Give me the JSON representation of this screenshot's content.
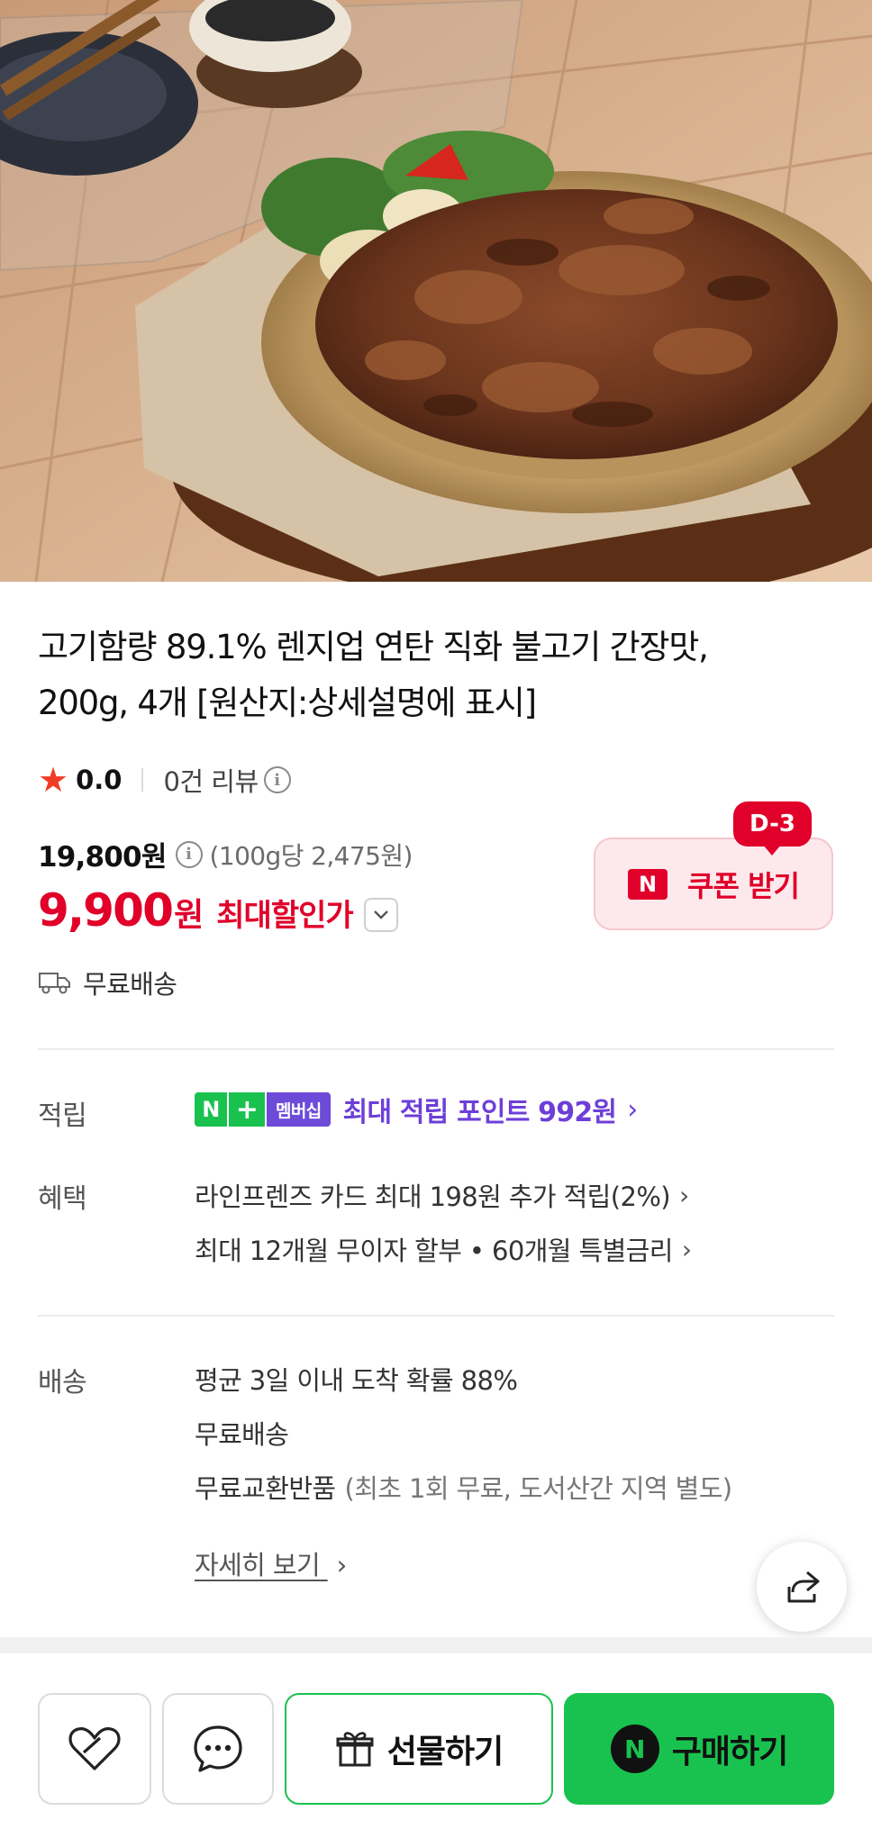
{
  "product": {
    "title_line1": "고기함량 89.1% 렌지업 연탄 직화 불고기 간장맛,",
    "title_line2": "200g, 4개 [원산지:상세설명에 표시]",
    "image_icon": "bulgogi-plate-photo"
  },
  "rating": {
    "star_icon": "star-icon",
    "value": "0.0",
    "review_count": "0건 리뷰"
  },
  "price": {
    "original": "19,800원",
    "unit_price": "(100g당 2,475원)",
    "sale_amount": "9,900",
    "sale_currency": "원",
    "sale_label": "최대할인가"
  },
  "coupon": {
    "badge": "D-3",
    "n_label": "N",
    "label": "쿠폰 받기"
  },
  "shipping_summary": "무료배송",
  "points": {
    "label": "적립",
    "badge_n": "N",
    "badge_plus": "+",
    "badge_membership": "멤버십",
    "text": "최대 적립 포인트 992원"
  },
  "benefits": {
    "label": "혜택",
    "items": [
      "라인프렌즈 카드 최대 198원 추가 적립(2%)",
      "최대 12개월 무이자 할부 • 60개월 특별금리"
    ]
  },
  "delivery": {
    "label": "배송",
    "line1": "평균 3일 이내 도착 확률 88%",
    "line2": "무료배송",
    "line3_main": "무료교환반품",
    "line3_note": "(최초 1회 무료, 도서산간 지역 별도)",
    "detail_link": "자세히 보기"
  },
  "bottom_bar": {
    "gift_label": "선물하기",
    "buy_n": "N",
    "buy_label": "구매하기"
  },
  "colors": {
    "sale_red": "#e0002a",
    "naver_green": "#19c24f",
    "membership_purple": "#6d3fd8"
  }
}
